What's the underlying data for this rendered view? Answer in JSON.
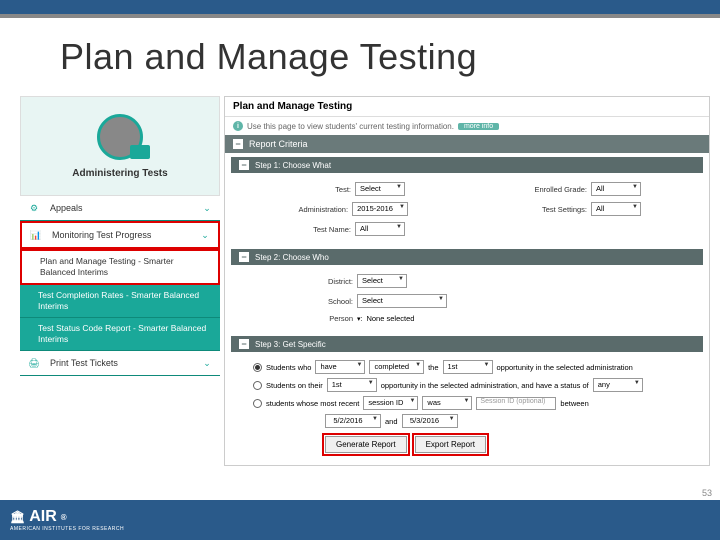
{
  "slide": {
    "title": "Plan and Manage Testing",
    "page_number": "53"
  },
  "sidebar": {
    "avatar_label": "Administering Tests",
    "items": [
      {
        "icon": "gear",
        "label": "Appeals"
      },
      {
        "icon": "chart",
        "label": "Monitoring Test Progress"
      }
    ],
    "subitems": [
      "Plan and Manage Testing - Smarter Balanced Interims",
      "Test Completion Rates - Smarter Balanced Interims",
      "Test Status Code Report - Smarter Balanced Interims"
    ],
    "print_item": "Print Test Tickets"
  },
  "panel": {
    "title": "Plan and Manage Testing",
    "info_text": "Use this page to view students' current testing information.",
    "info_link": "more info",
    "criteria_header": "Report Criteria",
    "step1": {
      "header": "Step 1: Choose What",
      "fields": {
        "test_label": "Test:",
        "test_value": "Select",
        "admin_label": "Administration:",
        "admin_value": "2015-2016",
        "testname_label": "Test Name:",
        "testname_value": "All",
        "grade_label": "Enrolled Grade:",
        "grade_value": "All",
        "settings_label": "Test Settings:",
        "settings_value": "All"
      }
    },
    "step2": {
      "header": "Step 2: Choose Who",
      "fields": {
        "district_label": "District:",
        "district_value": "Select",
        "school_label": "School:",
        "school_value": "Select",
        "person_label": "Person",
        "person_value": "None selected"
      }
    },
    "step3": {
      "header": "Step 3: Get Specific",
      "opt1": {
        "a": "Students who",
        "sel1": "have",
        "sel2": "completed",
        "b": "the",
        "sel3": "1st",
        "c": "opportunity in the selected administration"
      },
      "opt2": {
        "a": "Students on their",
        "sel1": "1st",
        "b": "opportunity in the selected administration, and have a status of",
        "sel2": "any"
      },
      "opt3": {
        "a": "students whose most recent",
        "lbl1": "session ID",
        "lbl2": "was",
        "ph": "Session ID (optional)",
        "b": "between"
      },
      "dates": {
        "from": "5/2/2016",
        "to_label": "and",
        "to": "5/3/2016"
      }
    },
    "buttons": {
      "generate": "Generate Report",
      "export": "Export Report"
    }
  },
  "footer": {
    "logo": "AIR",
    "subtitle": "AMERICAN INSTITUTES FOR RESEARCH"
  }
}
